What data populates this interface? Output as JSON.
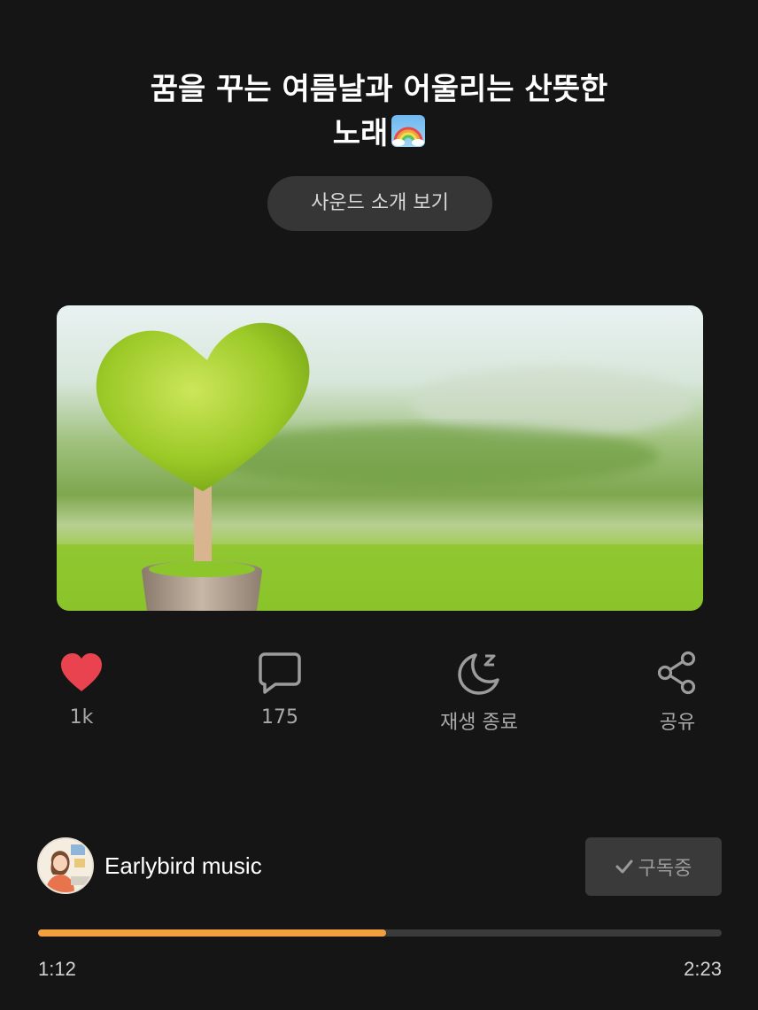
{
  "header": {
    "title_line1": "꿈을 꾸는 여름날과 어울리는 산뜻한",
    "title_line2": "노래",
    "title_emoji": "rainbow-emoji"
  },
  "intro_button": {
    "label": "사운드 소개 보기"
  },
  "cover": {
    "image": "green-heart-topiary-photo"
  },
  "actions": [
    {
      "icon": "heart-icon",
      "label": "1k",
      "color": "#e8434f"
    },
    {
      "icon": "comment-icon",
      "label": "175"
    },
    {
      "icon": "sleep-timer-icon",
      "label": "재생 종료"
    },
    {
      "icon": "share-icon",
      "label": "공유"
    }
  ],
  "channel": {
    "name": "Earlybird music",
    "subscribe_label": "구독중",
    "subscribe_icon": "check-icon"
  },
  "player": {
    "progress": 0.5095,
    "current_time": "1:12",
    "duration": "2:23",
    "accent": "#f2a03f"
  }
}
